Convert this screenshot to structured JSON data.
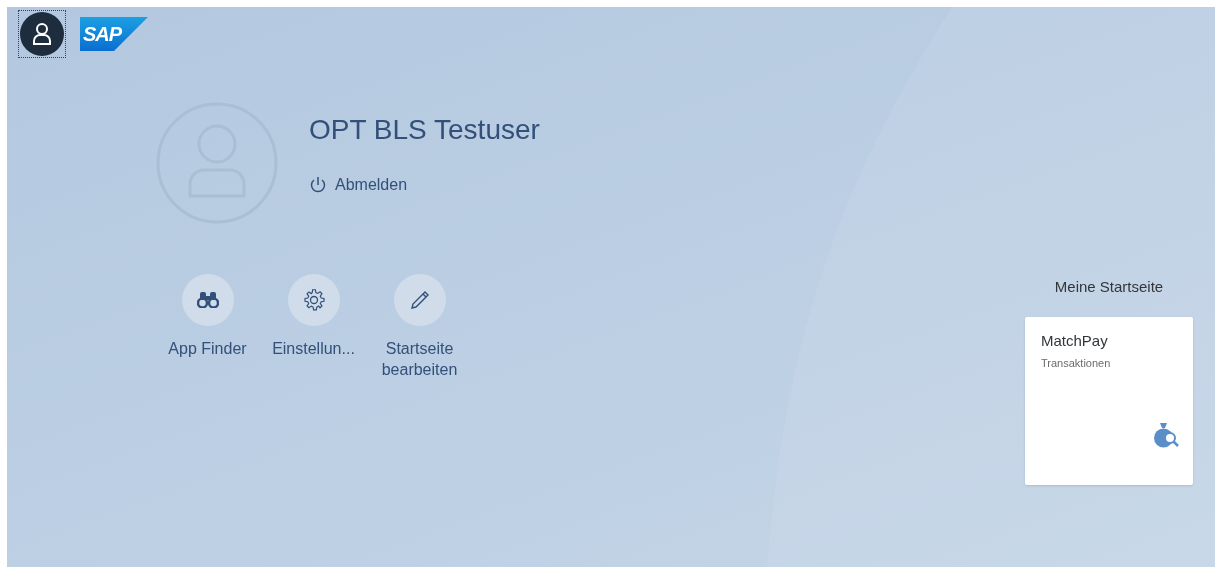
{
  "header": {
    "logo": "SAP"
  },
  "user": {
    "name": "OPT BLS Testuser",
    "logout": "Abmelden"
  },
  "actions": [
    {
      "kind": "finder",
      "label": "App Finder"
    },
    {
      "kind": "settings",
      "label": "Einstellun..."
    },
    {
      "kind": "edit",
      "label": "Startseite bearbeiten"
    }
  ],
  "home": {
    "title": "Meine Startseite",
    "tiles": [
      {
        "title": "MatchPay",
        "subtitle": "Transaktionen"
      }
    ]
  }
}
